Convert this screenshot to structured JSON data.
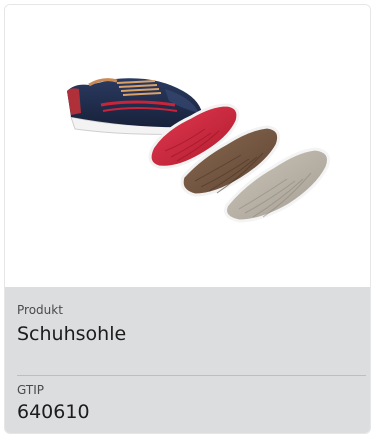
{
  "product_card": {
    "image_alt": "shoe-with-soles",
    "product_label": "Produkt",
    "product_value": "Schuhsohle",
    "gtip_label": "GTIP",
    "gtip_value": "640610"
  },
  "colors": {
    "info_background": "#dcdddf",
    "shoe_navy": "#1f2d4e",
    "sole_red": "#c8243a",
    "sole_brown": "#7a5c44",
    "sole_gray": "#b8b1a6"
  }
}
